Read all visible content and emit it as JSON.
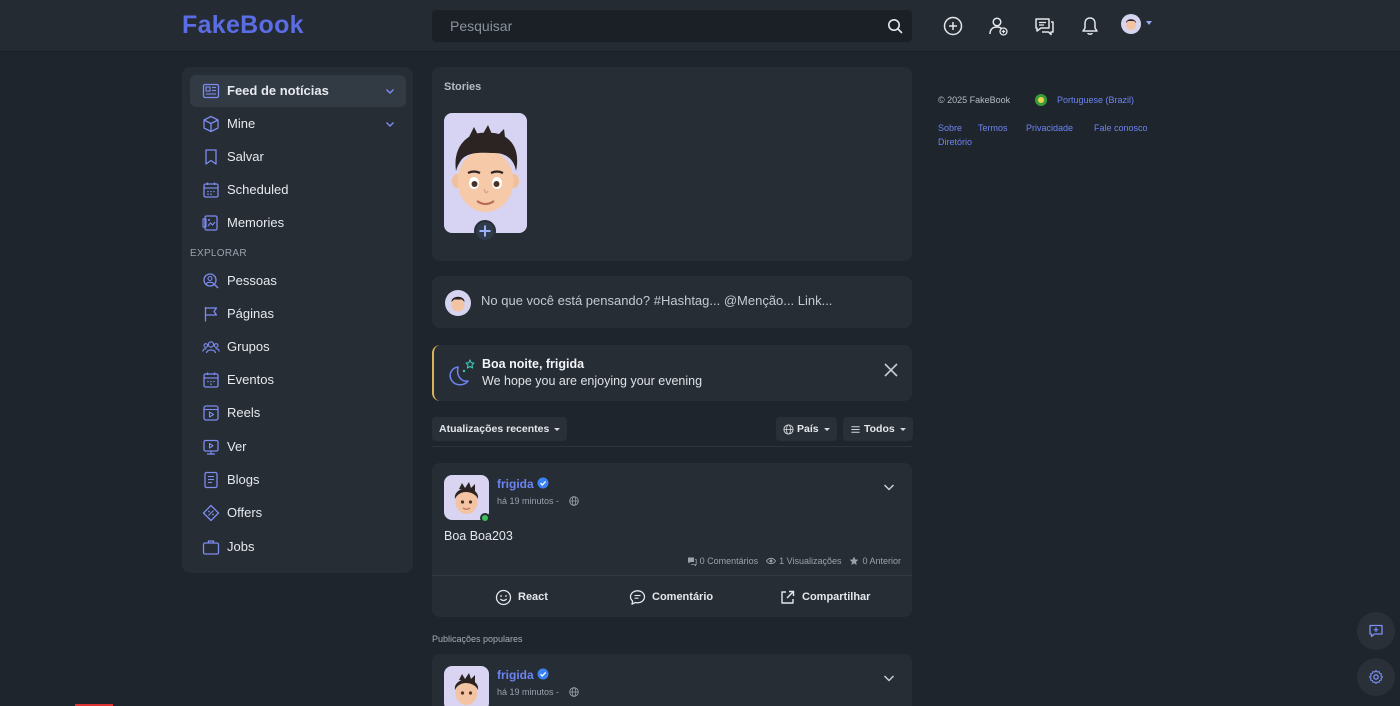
{
  "header": {
    "logo": "FakeBook",
    "search_placeholder": "Pesquisar"
  },
  "sidebar": {
    "items": [
      {
        "label": "Feed de notícias",
        "icon": "newspaper-icon",
        "active": true,
        "expandable": true
      },
      {
        "label": "Mine",
        "icon": "cube-icon",
        "expandable": true
      },
      {
        "label": "Salvar",
        "icon": "bookmark-icon"
      },
      {
        "label": "Scheduled",
        "icon": "calendar-icon"
      },
      {
        "label": "Memories",
        "icon": "memories-icon"
      }
    ],
    "section_label": "EXPLORAR",
    "explore": [
      {
        "label": "Pessoas",
        "icon": "people-search-icon"
      },
      {
        "label": "Páginas",
        "icon": "flag-icon"
      },
      {
        "label": "Grupos",
        "icon": "group-icon"
      },
      {
        "label": "Eventos",
        "icon": "event-calendar-icon"
      },
      {
        "label": "Reels",
        "icon": "reels-icon"
      },
      {
        "label": "Ver",
        "icon": "watch-icon"
      },
      {
        "label": "Blogs",
        "icon": "blog-icon"
      },
      {
        "label": "Offers",
        "icon": "offer-tag-icon"
      },
      {
        "label": "Jobs",
        "icon": "briefcase-icon"
      }
    ]
  },
  "stories": {
    "title": "Stories"
  },
  "composer": {
    "placeholder": "No que você está pensando? #Hashtag... @Menção... Link..."
  },
  "greeting": {
    "title": "Boa noite, frigida",
    "subtitle": "We hope you are enjoying your evening"
  },
  "filters": {
    "sort": "Atualizações recentes",
    "country": "País",
    "all": "Todos"
  },
  "post": {
    "author": "frigida",
    "time": "há 19 minutos -",
    "text": "Boa Boa203",
    "comments": "0 Comentários",
    "views": "1 Visualizações",
    "rating": "0 Anterior",
    "actions": {
      "react": "React",
      "comment": "Comentário",
      "share": "Compartilhar"
    }
  },
  "popular_label": "Publicações populares",
  "post2": {
    "author": "frigida",
    "time": "há 19 minutos -"
  },
  "footer": {
    "copyright": "© 2025 FakeBook",
    "language": "Portuguese (Brazil)",
    "links": [
      "Sobre",
      "Termos",
      "Privacidade",
      "Fale conosco",
      "Diretório"
    ]
  },
  "colors": {
    "accent": "#5b6de5",
    "link": "#6d84f3",
    "background": "#1f252c",
    "card": "#272d35",
    "online": "#3cbf55"
  }
}
